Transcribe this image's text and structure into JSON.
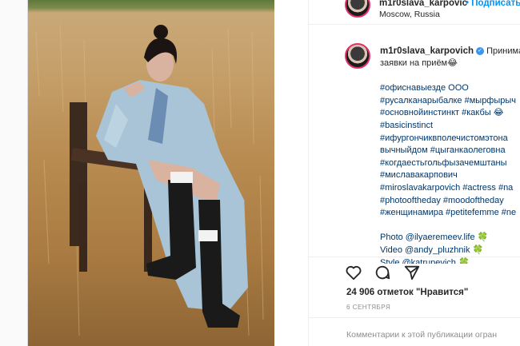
{
  "post": {
    "username": "m1r0slava_karpovich",
    "header_username": "m1r0slava_karpovic",
    "follow_label": "• Подписаться",
    "location": "Moscow, Russia",
    "caption_first": "Принима",
    "caption_lines": [
      "заявки на приём😂",
      "",
      "#офиснавыезде ООО",
      "#русалканарыбалке #мырфырыч",
      "#основнойинстинкт #какбы 😂",
      "#basicinstinct",
      "#ифургончиквполечистомэтона",
      "вычныйдом #цыганкаолеговна",
      "#когдаестьгольфызачемштаны",
      "#миславакарпович",
      "#miroslavakarpovich #actress #na",
      "#photooftheday #moodoftheday",
      "#женщинамира #petitefemme #ne",
      "",
      "Photo @ilyaeremeev.life 🍀",
      "Video @andy_pluzhnik 🍀",
      "Style @katrupevich 🍀"
    ],
    "likes": "24 906 отметок \"Нравится\"",
    "date": "6 СЕНТЯБРЯ",
    "comment_placeholder": "Комментарии к этой публикации огран"
  },
  "colors": {
    "link": "#00376b",
    "follow": "#0095f6",
    "story_ring": "#e1306c"
  },
  "icons": [
    "heart-icon",
    "comment-icon",
    "share-icon"
  ]
}
